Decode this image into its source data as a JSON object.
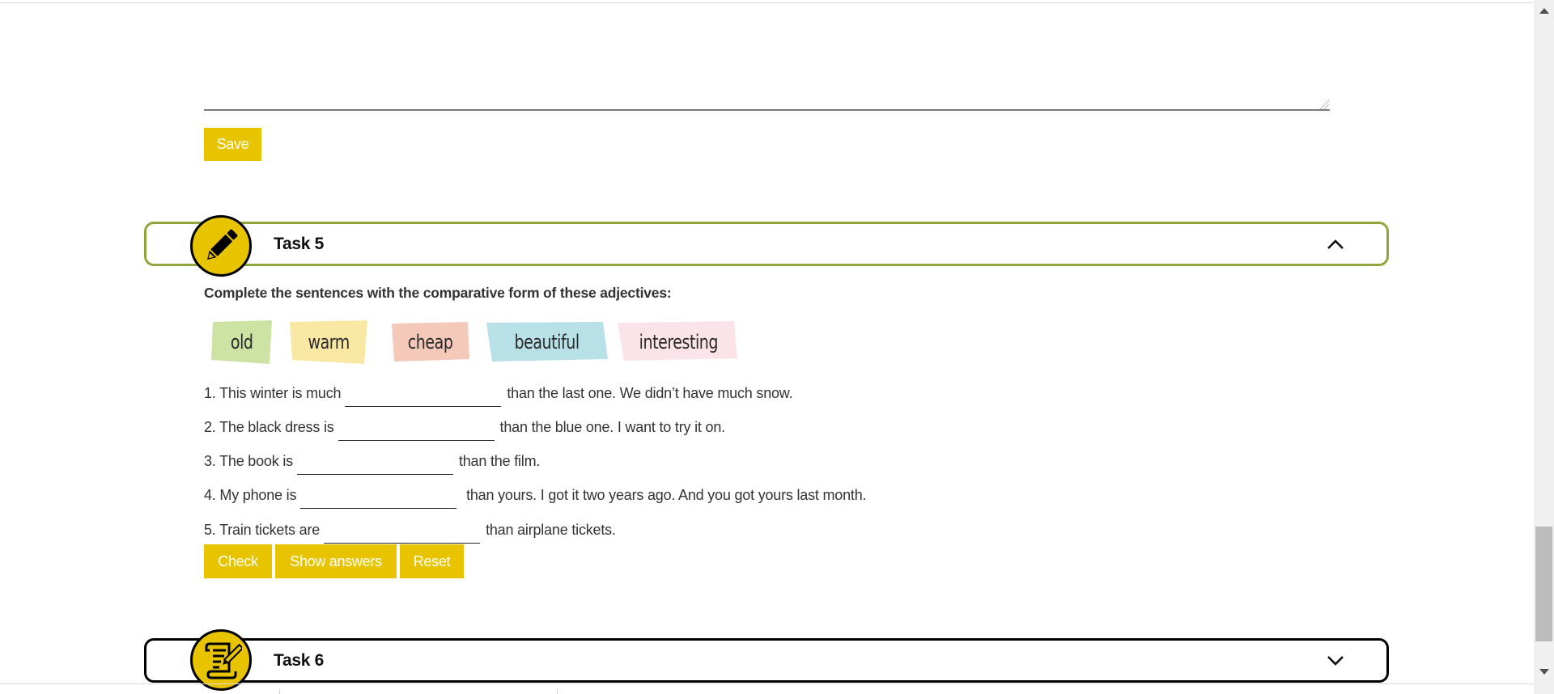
{
  "previous_task": {
    "textarea_value": "",
    "save_label": "Save"
  },
  "task5": {
    "title": "Task 5",
    "icon": "pencil-icon",
    "expanded": true,
    "instruction": "Complete the sentences with the comparative form of these adjectives:",
    "words": [
      {
        "text": "old",
        "color": "#cde3a4"
      },
      {
        "text": "warm",
        "color": "#f9e7a4"
      },
      {
        "text": "cheap",
        "color": "#f4c9ba"
      },
      {
        "text": "beautiful",
        "color": "#b8e0e7"
      },
      {
        "text": "interesting",
        "color": "#fbe3ea"
      }
    ],
    "sentences": [
      {
        "before": "1. This winter is much",
        "answer": "",
        "after": "than the last one. We didn’t have much snow."
      },
      {
        "before": "2. The black dress is",
        "answer": "",
        "after": "than the blue one. I want to try it on."
      },
      {
        "before": "3. The book is",
        "answer": "",
        "after": "than the film."
      },
      {
        "before": "4. My phone is",
        "answer": "",
        "after": " than yours. I got it two years ago. And you got yours last month."
      },
      {
        "before": "5. Train tickets are",
        "answer": "",
        "after": "than airplane tickets."
      }
    ],
    "buttons": {
      "check": "Check",
      "show_answers": "Show answers",
      "reset": "Reset"
    }
  },
  "task6": {
    "title": "Task 6",
    "icon": "scroll-with-pen-icon",
    "expanded": false
  },
  "colors": {
    "accent_yellow": "#e8c400",
    "task_active_border": "#8fa63c",
    "task_inactive_border": "#000000"
  }
}
